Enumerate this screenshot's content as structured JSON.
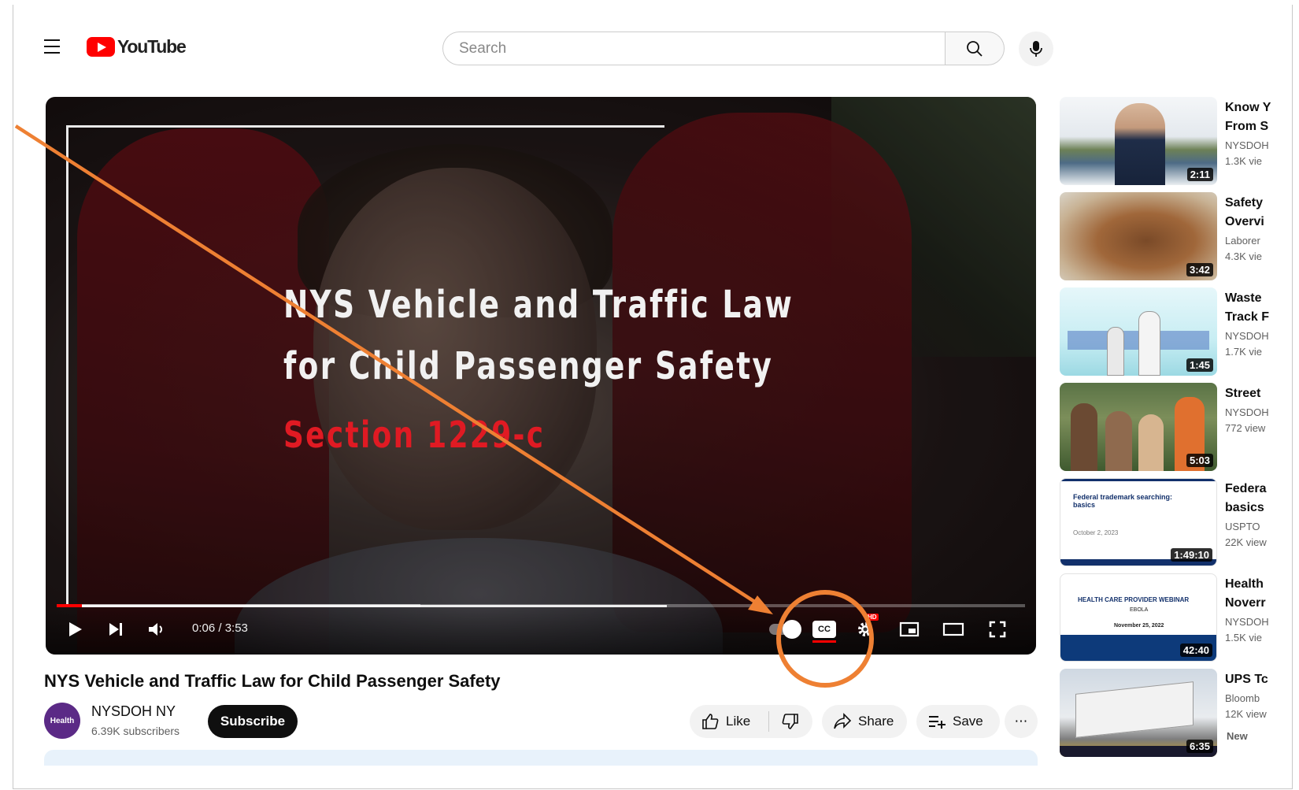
{
  "header": {
    "logo_text": "YouTube",
    "search_placeholder": "Search"
  },
  "player": {
    "overlay_line1": "NYS Vehicle and Traffic Law",
    "overlay_line2": "for Child Passenger Safety",
    "overlay_line3": "Section 1229-c",
    "time": "0:06 / 3:53",
    "played_fraction": 0.026,
    "buffered_fraction": 0.376,
    "cc_label": "CC",
    "hd_badge": "HD"
  },
  "video": {
    "title": "NYS Vehicle and Traffic Law for Child Passenger Safety",
    "channel_avatar_text": "Health",
    "channel_name": "NYSDOH NY",
    "subscribers": "6.39K subscribers",
    "subscribe_label": "Subscribe",
    "like_label": "Like",
    "share_label": "Share",
    "save_label": "Save",
    "more_label": "⋯"
  },
  "recommendations": [
    {
      "title": "Know Y",
      "title2": "From S",
      "channel": "NYSDOH",
      "views": "1.3K vie",
      "duration": "2:11"
    },
    {
      "title": "Safety",
      "title2": "Overvi",
      "channel": "Laborer",
      "views": "4.3K vie",
      "duration": "3:42"
    },
    {
      "title": "Waste",
      "title2": "Track F",
      "channel": "NYSDOH",
      "views": "1.7K vie",
      "duration": "1:45"
    },
    {
      "title": "Street",
      "title2": "",
      "channel": "NYSDOH",
      "views": "772 view",
      "duration": "5:03"
    },
    {
      "title": "Federa",
      "title2": "basics",
      "channel": "USPTO",
      "views": "22K view",
      "duration": "1:49:10",
      "thumb_text": "Federal trademark searching: basics",
      "thumb_sub": "October 2, 2023"
    },
    {
      "title": "Health",
      "title2": "Noverr",
      "channel": "NYSDOH",
      "views": "1.5K vie",
      "duration": "42:40",
      "thumb_text": "HEALTH CARE PROVIDER WEBINAR",
      "thumb_sub": "EBOLA",
      "thumb_date": "November 25, 2022"
    },
    {
      "title": "UPS Tc",
      "title2": "",
      "channel": "Bloomb",
      "views": "12K view",
      "duration": "6:35",
      "badge": "New"
    }
  ],
  "colors": {
    "brand_red": "#ff0000",
    "annotation": "#ee8033",
    "section_red": "#e01a23"
  }
}
